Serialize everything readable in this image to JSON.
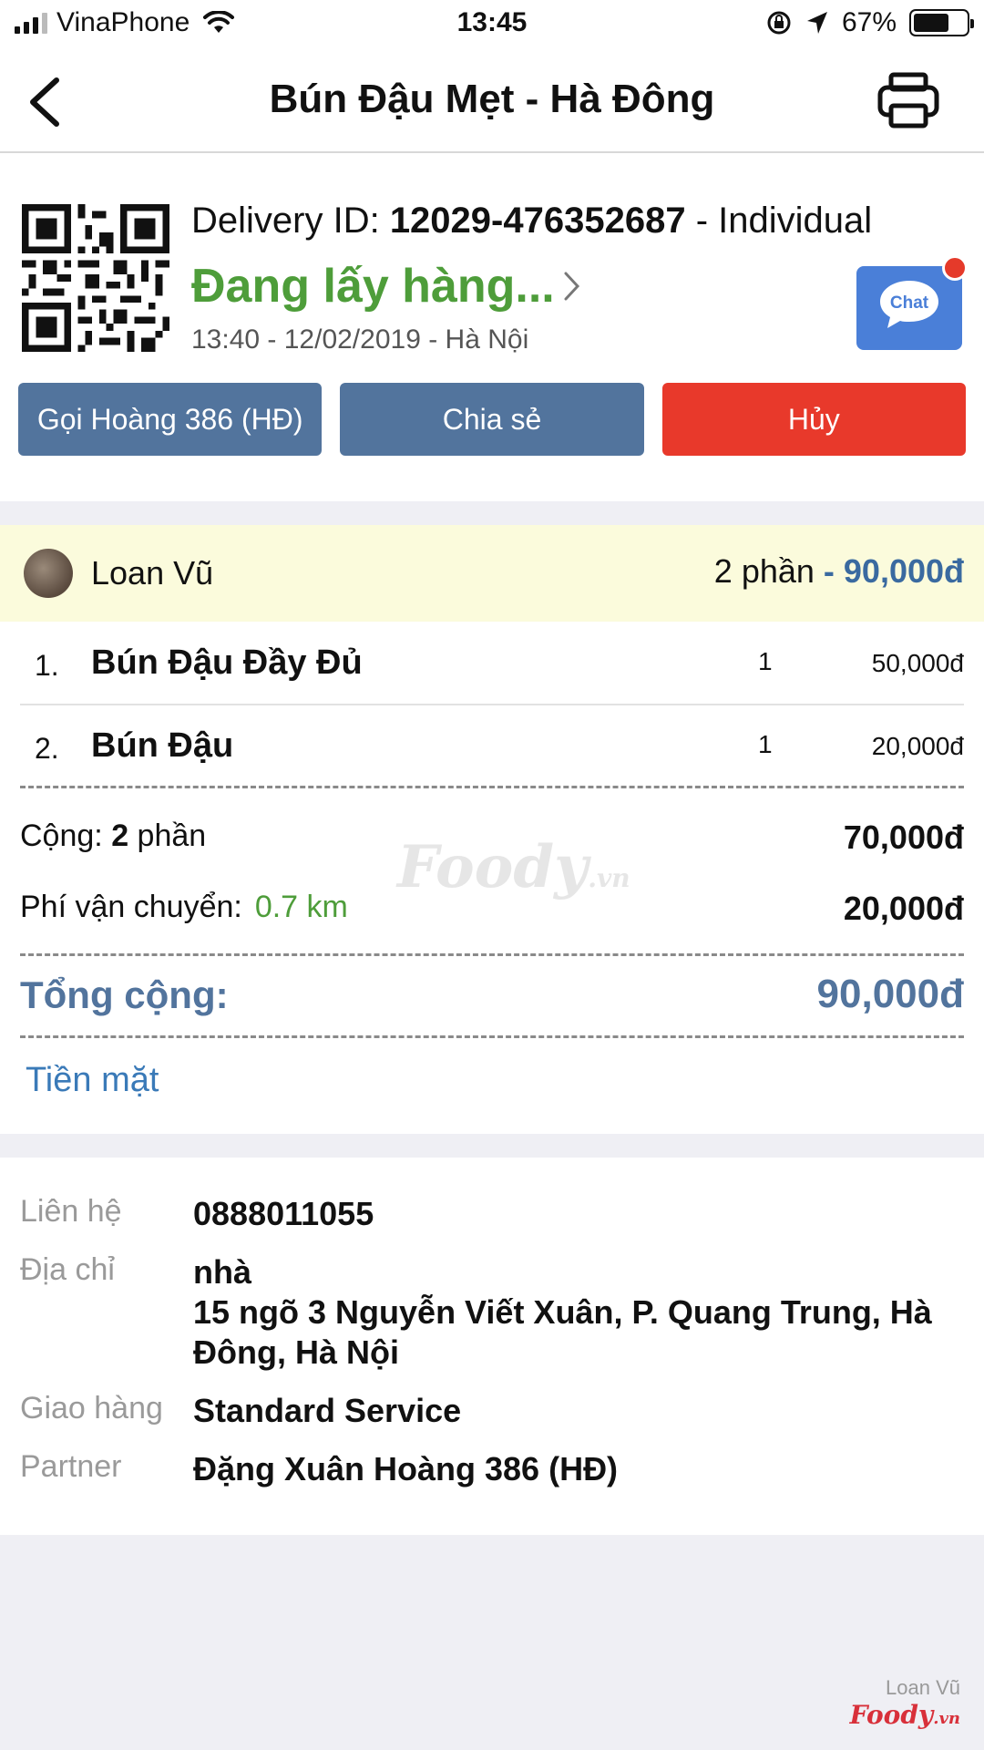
{
  "status_bar": {
    "carrier": "VinaPhone",
    "time": "13:45",
    "battery": "67%",
    "battery_level": 0.67
  },
  "nav": {
    "title": "Bún Đậu Mẹt - Hà Đông",
    "back_icon": "chevron-left-icon",
    "print_icon": "printer-icon"
  },
  "order": {
    "delivery_prefix": "Delivery ID: ",
    "delivery_id": "12029-476352687",
    "delivery_type": " - Individual",
    "status": "Đang lấy hàng...",
    "time_place": "13:40 - 12/02/2019 - Hà Nội",
    "chat_label": "Chat",
    "buttons": {
      "call": "Gọi Hoàng 386 (HĐ)",
      "share": "Chia sẻ",
      "cancel": "Hủy"
    }
  },
  "customer": {
    "name": "Loan Vũ",
    "portions": "2 phần",
    "amount": " - 90,000đ"
  },
  "items": [
    {
      "index": "1.",
      "name": "Bún Đậu Đầy Đủ",
      "qty": "1",
      "price": "50,000đ"
    },
    {
      "index": "2.",
      "name": "Bún Đậu",
      "qty": "1",
      "price": "20,000đ"
    }
  ],
  "summary": {
    "subtotal_label": "Cộng: ",
    "subtotal_count": "2",
    "subtotal_unit": " phần",
    "subtotal_value": "70,000đ",
    "shipping_label": "Phí vận chuyển:",
    "shipping_distance": "0.7 km",
    "shipping_value": "20,000đ",
    "total_label": "Tổng cộng:",
    "total_value": "90,000đ",
    "payment_method": "Tiền mặt"
  },
  "watermark": {
    "brand": "Foody",
    "suffix": ".vn"
  },
  "info": {
    "contact_label": "Liên hệ",
    "contact_value": "0888011055",
    "address_label": "Địa chỉ",
    "address_line1": "nhà",
    "address_line2": "15 ngõ 3 Nguyễn Viết Xuân, P. Quang Trung, Hà Đông, Hà Nội",
    "delivery_label": "Giao hàng",
    "delivery_value": "Standard Service",
    "partner_label": "Partner",
    "partner_value": "Đặng Xuân Hoàng 386 (HĐ)"
  },
  "footer": {
    "user": "Loan Vũ",
    "brand": "Foody",
    "suffix": ".vn"
  },
  "colors": {
    "status_green": "#4e9d3a",
    "button_blue": "#52749d",
    "button_red": "#e8392b",
    "chat_blue": "#4a7fd8"
  }
}
